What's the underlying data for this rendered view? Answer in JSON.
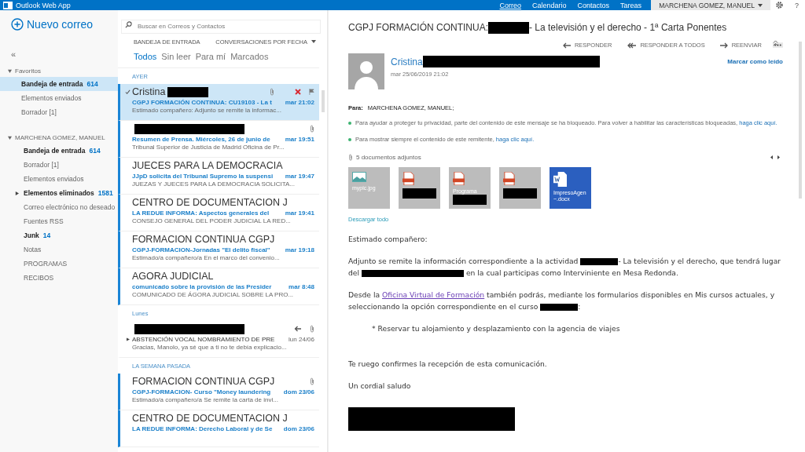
{
  "top_bar": {
    "app_name": "Outlook Web App",
    "nav": [
      {
        "label": "Correo",
        "selected": true
      },
      {
        "label": "Calendario",
        "selected": false
      },
      {
        "label": "Contactos",
        "selected": false
      },
      {
        "label": "Tareas",
        "selected": false
      }
    ],
    "user": "MARCHENA GOMEZ, MANUEL",
    "help": "?"
  },
  "sidebar": {
    "new_mail": "Nuevo correo",
    "collapse": "«",
    "sections": [
      {
        "title": "Favoritos",
        "expanded": true,
        "folders": [
          {
            "label": "Bandeja de entrada",
            "count": "614",
            "bold": true,
            "selected": true,
            "expandable": false
          },
          {
            "label": "Elementos enviados",
            "bold": false,
            "selected": false,
            "expandable": false
          },
          {
            "label": "Borrador [1]",
            "bold": false,
            "selected": false,
            "expandable": false
          }
        ]
      },
      {
        "title": "MARCHENA GOMEZ, MANUEL",
        "expanded": true,
        "folders": [
          {
            "label": "Bandeja de entrada",
            "count": "614",
            "bold": true,
            "selected": false,
            "expandable": false
          },
          {
            "label": "Borrador [1]",
            "bold": false,
            "selected": false,
            "expandable": false
          },
          {
            "label": "Elementos enviados",
            "bold": false,
            "selected": false,
            "expandable": false
          },
          {
            "label": "Elementos eliminados",
            "count": "1581",
            "bold": true,
            "selected": false,
            "expandable": true
          },
          {
            "label": "Correo electrónico no deseado",
            "bold": false,
            "selected": false,
            "expandable": false
          },
          {
            "label": "Fuentes RSS",
            "bold": false,
            "selected": false,
            "expandable": false
          },
          {
            "label": "Junk",
            "count": "14",
            "bold": true,
            "selected": false,
            "expandable": false
          },
          {
            "label": "Notas",
            "bold": false,
            "selected": false,
            "expandable": false
          },
          {
            "label": "PROGRAMAS",
            "bold": false,
            "selected": false,
            "expandable": false
          },
          {
            "label": "RECIBOS",
            "bold": false,
            "selected": false,
            "expandable": false
          }
        ]
      }
    ]
  },
  "message_list": {
    "search": {
      "placeholder": "Buscar en Correos y Contactos"
    },
    "folder_title": "BANDEJA DE ENTRADA",
    "sort": "CONVERSACIONES POR FECHA",
    "filters": [
      {
        "label": "Todos",
        "selected": true
      },
      {
        "label": "Sin leer",
        "selected": false
      },
      {
        "label": "Para mí",
        "selected": false
      },
      {
        "label": "Marcados",
        "selected": false
      }
    ],
    "groups": [
      {
        "title": "AYER",
        "messages": [
          {
            "sender": [
              {
                "text": "Cristina"
              },
              {
                "kind": "redacted"
              }
            ],
            "subject": "CGPJ FORMACIÓN CONTINUA: CU19103 - La t",
            "time": "mar 21:02",
            "preview": "Estimado compañero:  Adjunto se remite la informac...",
            "unread": true,
            "selected": true,
            "attachment": true,
            "replied": false,
            "expandable": false
          },
          {
            "sender": [
              {
                "kind": "redacted"
              }
            ],
            "subject": "Resumen de Prensa. Miércoles, 26 de junio de",
            "time": "mar 19:51",
            "preview": "Tribunal Superior de Justicia de Madrid Oficina de Pr...",
            "unread": true,
            "selected": false,
            "attachment": true,
            "replied": false,
            "expandable": false
          },
          {
            "sender": [
              {
                "text": "JUECES PARA LA DEMOCRACIA"
              }
            ],
            "subject": "JJpD solicita del Tribunal Supremo la suspensi",
            "time": "mar 19:47",
            "preview": "JUEZAS Y JUECES PARA LA DEMOCRACIA SOLICITA...",
            "unread": true,
            "selected": false,
            "attachment": false,
            "replied": false,
            "expandable": false
          },
          {
            "sender": [
              {
                "text": "CENTRO DE DOCUMENTACION J"
              }
            ],
            "subject": "LA REDUE INFORMA: Aspectos generales del",
            "time": "mar 19:41",
            "preview": "CONSEJO GENERAL DEL PODER JUDICIAL   LA RED...",
            "unread": true,
            "selected": false,
            "attachment": false,
            "replied": false,
            "expandable": false
          },
          {
            "sender": [
              {
                "text": "FORMACION CONTINUA CGPJ"
              }
            ],
            "subject": "CGPJ-FORMACION-Jornadas \"El delito fiscal\"",
            "time": "mar 19:18",
            "preview": "Estimado/a compañero/a    En el marco del convenio...",
            "unread": true,
            "selected": false,
            "attachment": false,
            "replied": false,
            "expandable": false
          },
          {
            "sender": [
              {
                "text": "AGORA JUDICIAL"
              }
            ],
            "subject": "comunicado sobre la provisión de las Presider",
            "time": "mar 8:48",
            "preview": "COMUNICADO DE ÁGORA JUDICIAL SOBRE LA PRO...",
            "unread": true,
            "selected": false,
            "attachment": false,
            "replied": false,
            "expandable": false
          }
        ]
      },
      {
        "title": "Lunes",
        "messages": [
          {
            "sender": [
              {
                "kind": "redacted"
              }
            ],
            "subject": "ABSTENCIÓN VOCAL NOMBRAMIENTO DE PRE",
            "time": "lun 24/06",
            "preview": "Gracias, Manolo, ya sé que a ti no te debía explicacio...",
            "unread": false,
            "selected": false,
            "attachment": true,
            "replied": true,
            "expandable": true
          }
        ]
      },
      {
        "title": "LA SEMANA PASADA",
        "messages": [
          {
            "sender": [
              {
                "text": "FORMACION CONTINUA CGPJ"
              }
            ],
            "subject": "CGPJ-FORMACION- Curso \"Money laundering",
            "time": "dom 23/06",
            "preview": "Estimado/a compañero/a    Se remite la carta de invi...",
            "unread": true,
            "selected": false,
            "attachment": true,
            "replied": false,
            "expandable": false
          },
          {
            "sender": [
              {
                "text": "CENTRO DE DOCUMENTACION J"
              }
            ],
            "subject": "LA REDUE INFORMA: Derecho Laboral y de Se",
            "time": "dom 23/06",
            "unread": true,
            "selected": false,
            "attachment": false,
            "replied": false,
            "expandable": false
          }
        ]
      }
    ]
  },
  "reading_pane": {
    "subject": [
      {
        "text": "CGPJ FORMACIÓN CONTINUA: "
      },
      {
        "kind": "redacted"
      },
      {
        "text": "- La televisión y el derecho - 1ª Carta Ponentes"
      }
    ],
    "actions": [
      "RESPONDER",
      "RESPONDER A TODOS",
      "REENVIAR"
    ],
    "sender": [
      {
        "text": "Cristina"
      },
      {
        "kind": "redacted"
      }
    ],
    "date": "mar 25/06/2019 21:02",
    "mark_read": "Marcar como leído",
    "to_label": "Para:",
    "to": "MARCHENA GOMEZ, MANUEL;",
    "notices": [
      [
        {
          "text": "Para ayudar a proteger tu privacidad, parte del contenido de este mensaje se ha bloqueado. Para volver a habilitar las características bloqueadas, "
        },
        {
          "kind": "link",
          "text": "haga clic aquí."
        }
      ],
      [
        {
          "text": "Para mostrar siempre el contenido de este remitente, "
        },
        {
          "kind": "link",
          "text": "haga clic aquí."
        }
      ]
    ],
    "attachments_title": "5 documentos adjuntos",
    "attachments": [
      {
        "kind": "image",
        "name": [
          {
            "text": "mypic.jpg"
          }
        ]
      },
      {
        "kind": "pdf",
        "name": [
          {
            "kind": "redacted"
          }
        ]
      },
      {
        "kind": "pdf",
        "name": [
          {
            "text": "Programa"
          },
          {
            "kind": "redacted"
          }
        ]
      },
      {
        "kind": "pdf",
        "name": [
          {
            "kind": "redacted"
          }
        ]
      },
      {
        "kind": "word",
        "name": [
          {
            "text": "ImpresoAgen ~.docx"
          }
        ]
      }
    ],
    "download_all": "Descargar todo",
    "body": [
      {
        "kind": "paragraph",
        "segments": [
          {
            "text": "Estimado compañero:"
          }
        ]
      },
      {
        "kind": "paragraph",
        "segments": [
          {
            "text": "Adjunto se remite la información correspondiente a la actividad "
          },
          {
            "kind": "redacted"
          },
          {
            "text": "- La televisión y el derecho,  que tendrá lugar del "
          },
          {
            "kind": "redacted"
          },
          {
            "text": " en la cual participas como Interviniente en Mesa Redonda."
          }
        ]
      },
      {
        "kind": "paragraph",
        "segments": [
          {
            "text": "Desde la "
          },
          {
            "kind": "link",
            "text": "Oficina Virtual de Formación"
          },
          {
            "text": " también podrás, mediante los formularios disponibles en Mis cursos actuales, y seleccionando la opción correspondiente en el curso "
          },
          {
            "kind": "redacted"
          },
          {
            "text": ":"
          }
        ]
      },
      {
        "kind": "bullet",
        "segments": [
          {
            "text": "* Reservar tu alojamiento y desplazamiento con la agencia de viajes"
          }
        ]
      },
      {
        "kind": "paragraph",
        "segments": [
          {
            "text": "Te ruego confirmes la recepción de esta comunicación."
          }
        ]
      },
      {
        "kind": "paragraph",
        "segments": [
          {
            "text": "Un cordial saludo"
          }
        ]
      },
      {
        "kind": "signature",
        "segments": [
          {
            "kind": "redacted"
          }
        ]
      }
    ]
  }
}
